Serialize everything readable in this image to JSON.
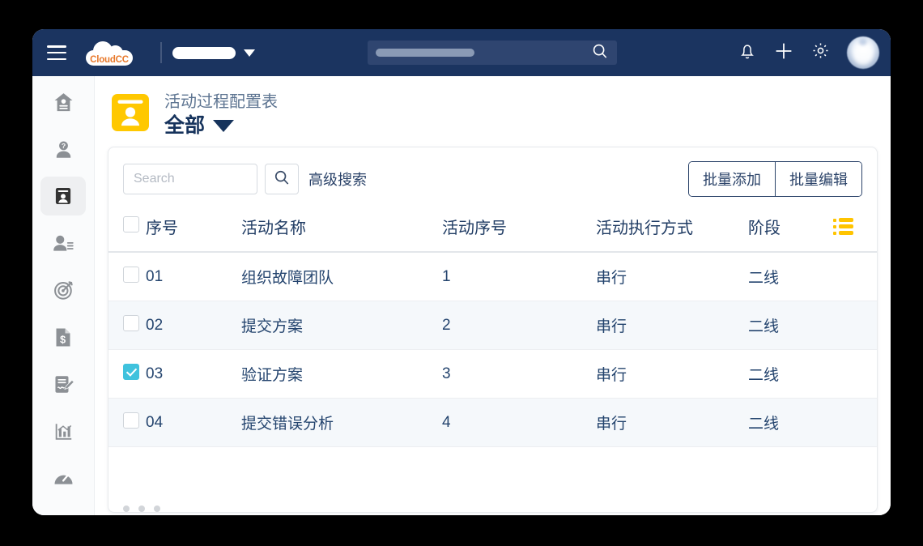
{
  "topbar": {
    "menu_icon": "hamburger-menu-icon",
    "logo_text": "CloudCC",
    "org_selector_value": "",
    "org_selector_redacted": true,
    "search_placeholder": "",
    "search_redacted": true,
    "search_icon": "search-icon",
    "notification_icon": "bell-icon",
    "add_icon": "plus-icon",
    "settings_icon": "gear-icon",
    "avatar_icon": "user-avatar",
    "bg_color": "#1b3460"
  },
  "sidebar": {
    "items": [
      {
        "name": "home",
        "icon": "home-person-icon",
        "active": false
      },
      {
        "name": "help",
        "icon": "person-question-icon",
        "active": false
      },
      {
        "name": "contacts",
        "icon": "contact-book-icon",
        "active": true
      },
      {
        "name": "leads",
        "icon": "person-list-icon",
        "active": false
      },
      {
        "name": "targets",
        "icon": "target-icon",
        "active": false
      },
      {
        "name": "invoices",
        "icon": "invoice-dollar-icon",
        "active": false
      },
      {
        "name": "contracts",
        "icon": "document-signature-icon",
        "active": false
      },
      {
        "name": "reports",
        "icon": "bar-chart-icon",
        "active": false
      },
      {
        "name": "dashboard",
        "icon": "gauge-icon",
        "active": false
      }
    ]
  },
  "page": {
    "icon": "contact-book-icon",
    "icon_color": "#ffc800",
    "subtitle": "活动过程配置表",
    "title": "全部",
    "dropdown_icon": "triangle-down-icon"
  },
  "toolbar": {
    "search_placeholder": "Search",
    "search_value": "",
    "search_button_icon": "search-icon",
    "advanced_search_label": "高级搜索",
    "batch_add_label": "批量添加",
    "batch_edit_label": "批量编辑"
  },
  "table": {
    "select_all_checked": false,
    "settings_icon": "list-settings-icon",
    "settings_icon_color": "#ffc400",
    "headers": {
      "sn": "序号",
      "name": "活动名称",
      "seq": "活动序号",
      "mode": "活动执行方式",
      "stage": "阶段"
    },
    "rows": [
      {
        "checked": false,
        "sn": "01",
        "name": "组织故障团队",
        "seq": "1",
        "mode": "串行",
        "stage": "二线"
      },
      {
        "checked": false,
        "sn": "02",
        "name": "提交方案",
        "seq": "2",
        "mode": "串行",
        "stage": "二线"
      },
      {
        "checked": true,
        "sn": "03",
        "name": "验证方案",
        "seq": "3",
        "mode": "串行",
        "stage": "二线"
      },
      {
        "checked": false,
        "sn": "04",
        "name": "提交错误分析",
        "seq": "4",
        "mode": "串行",
        "stage": "二线"
      }
    ]
  },
  "footer": {
    "pager_dots": 3
  },
  "colors": {
    "navy": "#1b3460",
    "text_navy": "#24446e",
    "accent_yellow": "#ffc800",
    "checkbox_checked": "#3fc2dd",
    "row_alt": "#f5f8fb"
  }
}
